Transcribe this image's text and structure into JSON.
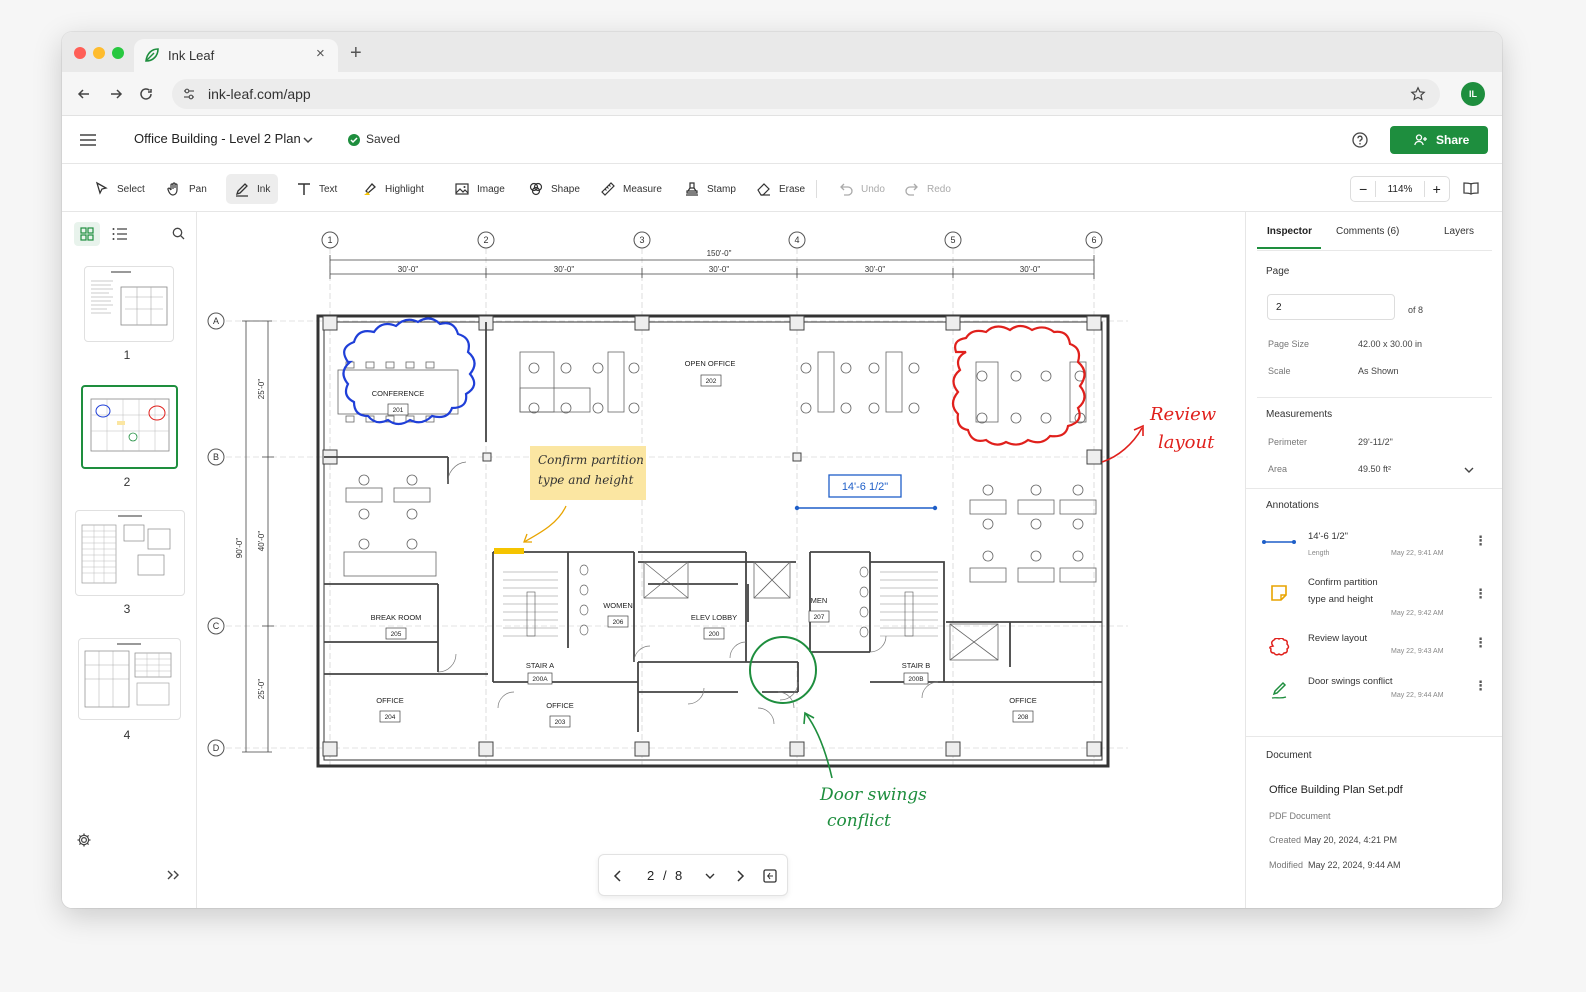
{
  "browser": {
    "tab_title": "Ink Leaf",
    "tab_close": "×",
    "new_tab": "+",
    "url": "ink-leaf.com/app",
    "avatar_initials": "IL"
  },
  "header": {
    "doc_title": "Office Building - Level 2 Plan",
    "saved_label": "Saved",
    "share_label": "Share"
  },
  "toolbar": {
    "tools": [
      "Select",
      "Pan",
      "Ink",
      "Text",
      "Highlight",
      "Image",
      "Shape",
      "Measure",
      "Stamp",
      "Erase",
      "Undo",
      "Redo"
    ],
    "active_tool": "Ink",
    "zoom": "114%",
    "zoom_minus": "−",
    "zoom_plus": "+"
  },
  "thumbnails": {
    "pages": [
      "1",
      "2",
      "3",
      "4"
    ],
    "selected": "2"
  },
  "plan": {
    "grid_cols": [
      "1",
      "2",
      "3",
      "4",
      "5",
      "6"
    ],
    "grid_rows": [
      "A",
      "B",
      "C",
      "D"
    ],
    "overall_dim": "150'-0\"",
    "bay_dims": [
      "30'-0\"",
      "30'-0\"",
      "30'-0\"",
      "30'-0\"",
      "30'-0\""
    ],
    "overall_vert": "90'-0\"",
    "vert_dims": [
      "25'-0\"",
      "40'-0\"",
      "25'-0\""
    ],
    "rooms": [
      {
        "name": "CONFERENCE",
        "num": "201"
      },
      {
        "name": "OPEN OFFICE",
        "num": "202"
      },
      {
        "name": "BREAK ROOM",
        "num": "205"
      },
      {
        "name": "WOMEN",
        "num": "206"
      },
      {
        "name": "ELEV LOBBY",
        "num": "200"
      },
      {
        "name": "MEN",
        "num": "207"
      },
      {
        "name": "STAIR A",
        "num": "200A"
      },
      {
        "name": "STAIR B",
        "num": "200B"
      },
      {
        "name": "OFFICE",
        "num": "204"
      },
      {
        "name": "OFFICE",
        "num": "203"
      },
      {
        "name": "OFFICE",
        "num": "208"
      }
    ]
  },
  "annotations_canvas": {
    "note_line1": "Confirm partition",
    "note_line2": "type and height",
    "measure_value": "14'-6 1/2\"",
    "review_line1": "Review",
    "review_line2": "layout",
    "door_line1": "Door swings",
    "door_line2": "conflict"
  },
  "pager": {
    "current": "2",
    "separator": "/",
    "total": "8"
  },
  "inspector": {
    "tabs": [
      "Inspector",
      "Comments (6)",
      "Layers"
    ],
    "page_heading": "Page",
    "page_value": "2",
    "page_of": "of 8",
    "page_size_label": "Page Size",
    "page_size_value": "42.00 x 30.00 in",
    "scale_label": "Scale",
    "scale_value": "As Shown",
    "measurements_heading": "Measurements",
    "perimeter_label": "Perimeter",
    "perimeter_value": "29'-11/2\"",
    "area_label": "Area",
    "area_value": "49.50 ft²",
    "annotations_heading": "Annotations",
    "annotations": [
      {
        "title": "14'-6 1/2\"",
        "sub": "Length",
        "date": "May 22, 9:41 AM"
      },
      {
        "title": "Confirm partition",
        "title2": "type and height",
        "date": "May 22, 9:42 AM"
      },
      {
        "title": "Review layout",
        "date": "May 22, 9:43 AM"
      },
      {
        "title": "Door swings conflict",
        "date": "May 22, 9:44 AM"
      }
    ],
    "document_heading": "Document",
    "doc_name": "Office Building Plan Set.pdf",
    "doc_type": "PDF Document",
    "created_label": "Created",
    "created_value": "May 20, 2024, 4:21 PM",
    "modified_label": "Modified",
    "modified_value": "May 22, 2024, 9:44 AM"
  },
  "colors": {
    "brand": "#1e8e3e",
    "cloud_blue": "#1f3fd8",
    "cloud_red": "#e0201c",
    "ink_green": "#1e8e3e",
    "note_yellow": "#fbe6a2",
    "measure_blue": "#1f5fc8"
  }
}
